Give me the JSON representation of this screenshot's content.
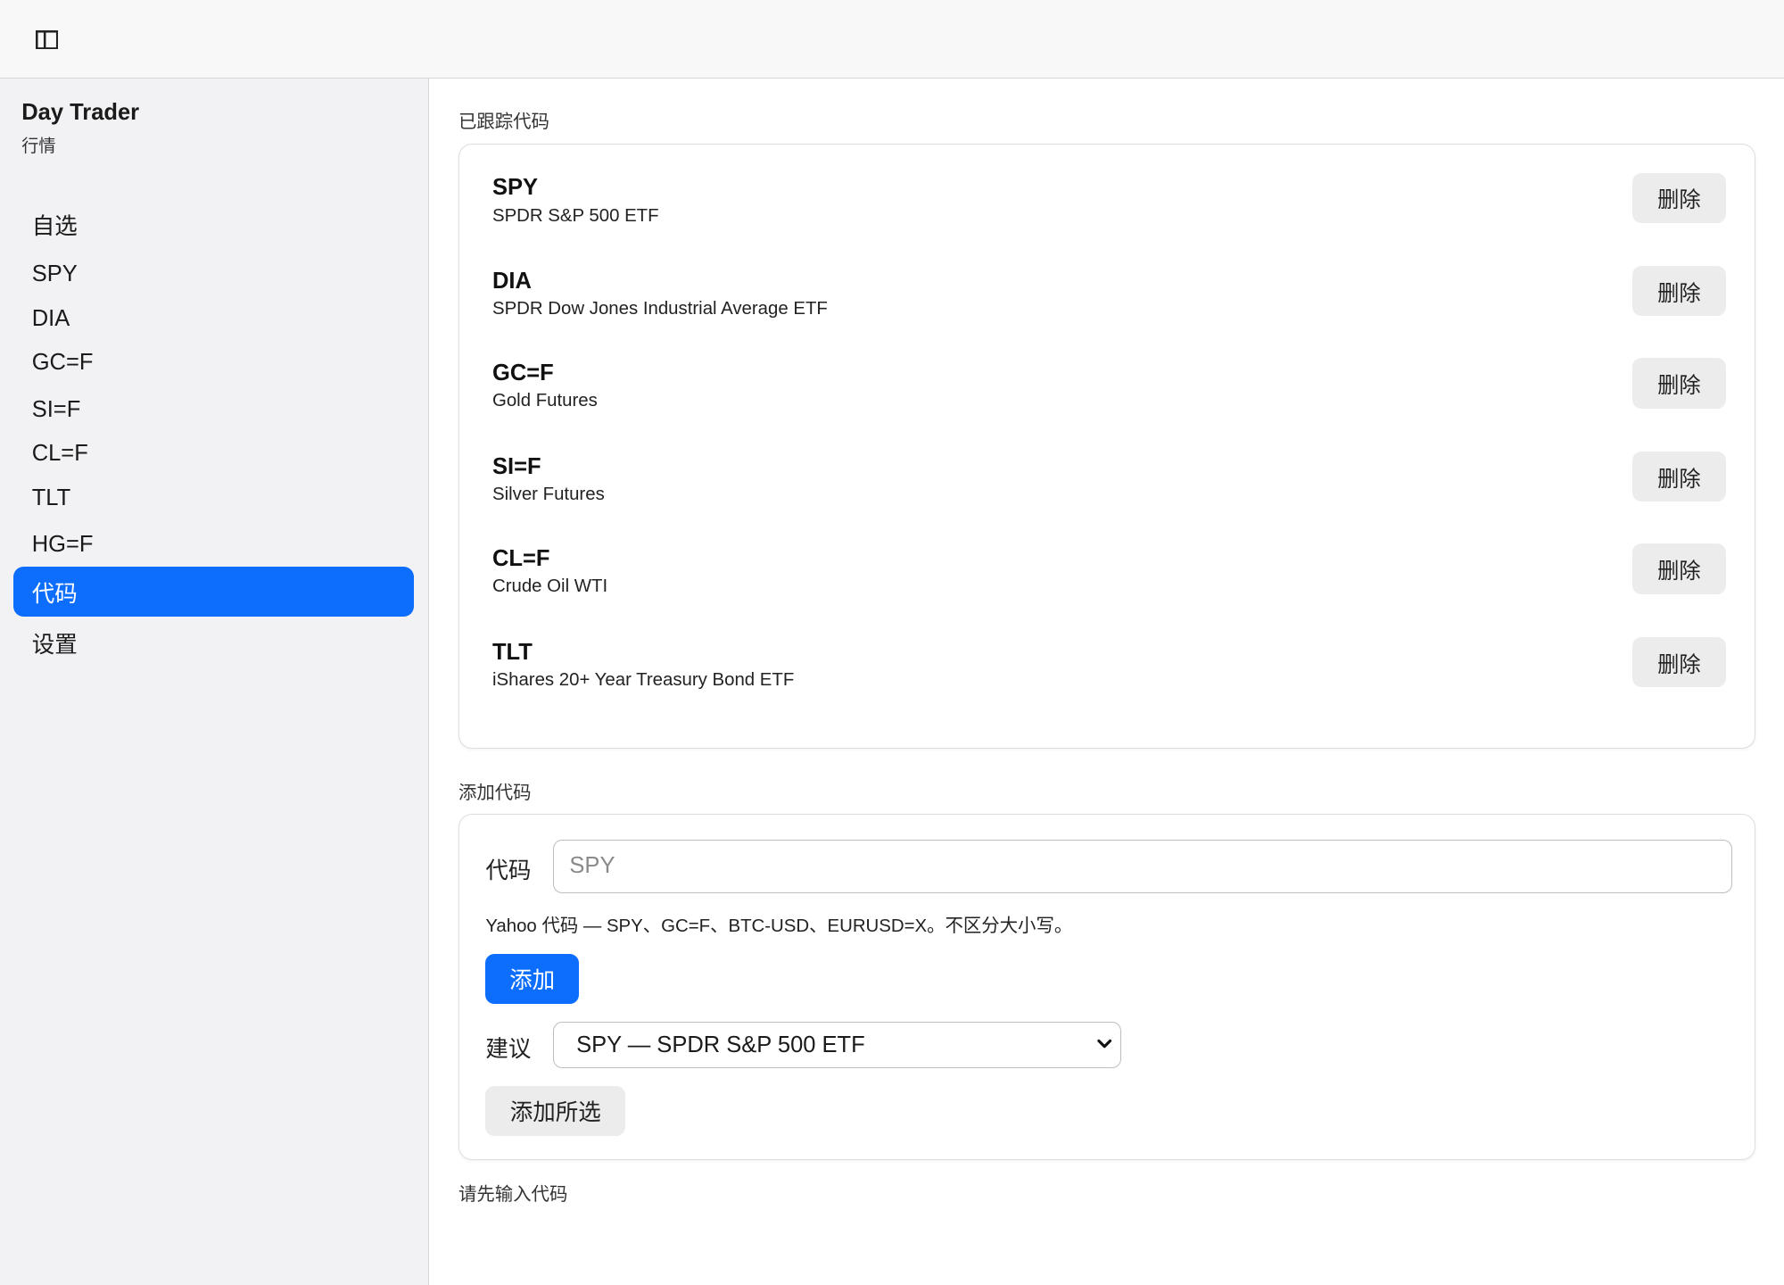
{
  "topbar": {
    "toggle_icon": "sidebar-toggle-icon"
  },
  "sidebar": {
    "title": "Day Trader",
    "subtitle": "行情",
    "items": [
      {
        "label": "自选",
        "active": false
      },
      {
        "label": "SPY",
        "active": false
      },
      {
        "label": "DIA",
        "active": false
      },
      {
        "label": "GC=F",
        "active": false
      },
      {
        "label": "SI=F",
        "active": false
      },
      {
        "label": "CL=F",
        "active": false
      },
      {
        "label": "TLT",
        "active": false
      },
      {
        "label": "HG=F",
        "active": false
      },
      {
        "label": "代码",
        "active": true
      },
      {
        "label": "设置",
        "active": false
      }
    ]
  },
  "tracked": {
    "heading": "已跟踪代码",
    "delete_label": "删除",
    "rows": [
      {
        "symbol": "SPY",
        "name": "SPDR S&P 500 ETF"
      },
      {
        "symbol": "DIA",
        "name": "SPDR Dow Jones Industrial Average ETF"
      },
      {
        "symbol": "GC=F",
        "name": "Gold Futures"
      },
      {
        "symbol": "SI=F",
        "name": "Silver Futures"
      },
      {
        "symbol": "CL=F",
        "name": "Crude Oil WTI"
      },
      {
        "symbol": "TLT",
        "name": "iShares 20+ Year Treasury Bond ETF"
      }
    ]
  },
  "add": {
    "heading": "添加代码",
    "symbol_label": "代码",
    "symbol_placeholder": "SPY",
    "symbol_value": "",
    "hint": "Yahoo 代码 — SPY、GC=F、BTC-USD、EURUSD=X。不区分大小写。",
    "add_label": "添加",
    "suggest_label": "建议",
    "suggest_selected": "SPY — SPDR S&P 500 ETF",
    "add_selected_label": "添加所选"
  },
  "status": "请先输入代码",
  "colors": {
    "accent": "#0d6efd",
    "sidebar_bg": "#f2f2f4",
    "button_bg": "#ececec"
  }
}
